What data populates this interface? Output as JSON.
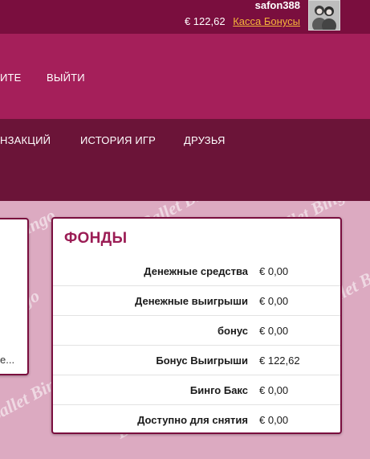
{
  "account": {
    "username": "safon388",
    "balance": "€ 122,62",
    "cashier_link": "Касса Бонусы"
  },
  "nav_primary": [
    {
      "label": "ИТЕ"
    },
    {
      "label": "ВЫЙТИ"
    }
  ],
  "nav_secondary": [
    {
      "label": "НЗАКЦИЙ"
    },
    {
      "label": "ИСТОРИЯ ИГР"
    },
    {
      "label": "ДРУЗЬЯ"
    }
  ],
  "left_panel": {
    "more_text": "е..."
  },
  "funds": {
    "title": "ФОНДЫ",
    "rows": [
      {
        "label": "Денежные средства",
        "value": "€ 0,00"
      },
      {
        "label": "Денежные выигрыши",
        "value": "€ 0,00"
      },
      {
        "label": "бонус",
        "value": "€ 0,00"
      },
      {
        "label": "Бонус Выигрыши",
        "value": "€ 122,62"
      },
      {
        "label": "Бинго Бакс",
        "value": "€ 0,00"
      },
      {
        "label": "Доступно для снятия",
        "value": "€ 0,00"
      }
    ]
  },
  "watermark": "Ballet Bingo",
  "colors": {
    "top_bar": "#7a0e3e",
    "nav_primary_bg": "#a51f5a",
    "nav_secondary_bg": "#6b1438",
    "content_bg": "#dcaac1",
    "funds_title": "#9b1d55",
    "cashier_link": "#f5b43a"
  }
}
